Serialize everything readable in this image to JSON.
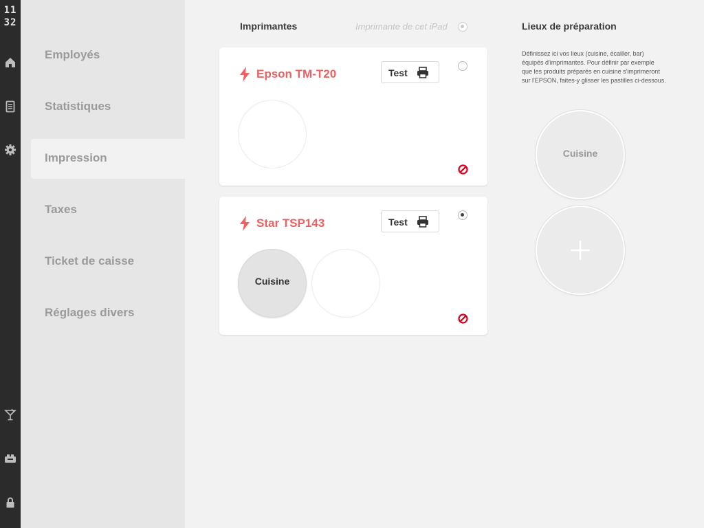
{
  "clock": {
    "hours": "11",
    "minutes": "32"
  },
  "rail_icons": [
    "home-icon",
    "document-icon",
    "gear-icon",
    "cocktail-icon",
    "cash-register-icon",
    "lock-icon"
  ],
  "menu": {
    "items": [
      {
        "label": "Employés",
        "selected": false
      },
      {
        "label": "Statistiques",
        "selected": false
      },
      {
        "label": "Impression",
        "selected": true
      },
      {
        "label": "Taxes",
        "selected": false
      },
      {
        "label": "Ticket de caisse",
        "selected": false
      },
      {
        "label": "Réglages divers",
        "selected": false
      }
    ]
  },
  "printers_section": {
    "title": "Imprimantes",
    "ipad_printer_label": "Imprimante de cet iPad"
  },
  "printers": [
    {
      "name": "Epson TM-T20",
      "test_label": "Test",
      "default_selected": false,
      "assigned_locations": []
    },
    {
      "name": "Star TSP143",
      "test_label": "Test",
      "default_selected": true,
      "assigned_locations": [
        "Cuisine"
      ]
    }
  ],
  "prep_section": {
    "title": "Lieux de préparation",
    "description": "Définissez ici vos lieux (cuisine, écailler, bar) équipés d'imprimantes. Pour définir par exemple que les produits préparés en cuisine s'imprimeront sur l'EPSON, faites-y glisser les pastilles ci-dessous.",
    "locations": [
      "Cuisine"
    ]
  },
  "colors": {
    "accent_red": "#ef6060",
    "rail": "#2b2b2b",
    "menu_bg": "#e6e6e6",
    "content_bg": "#f2f2f2",
    "ban_red": "#d9001b"
  }
}
